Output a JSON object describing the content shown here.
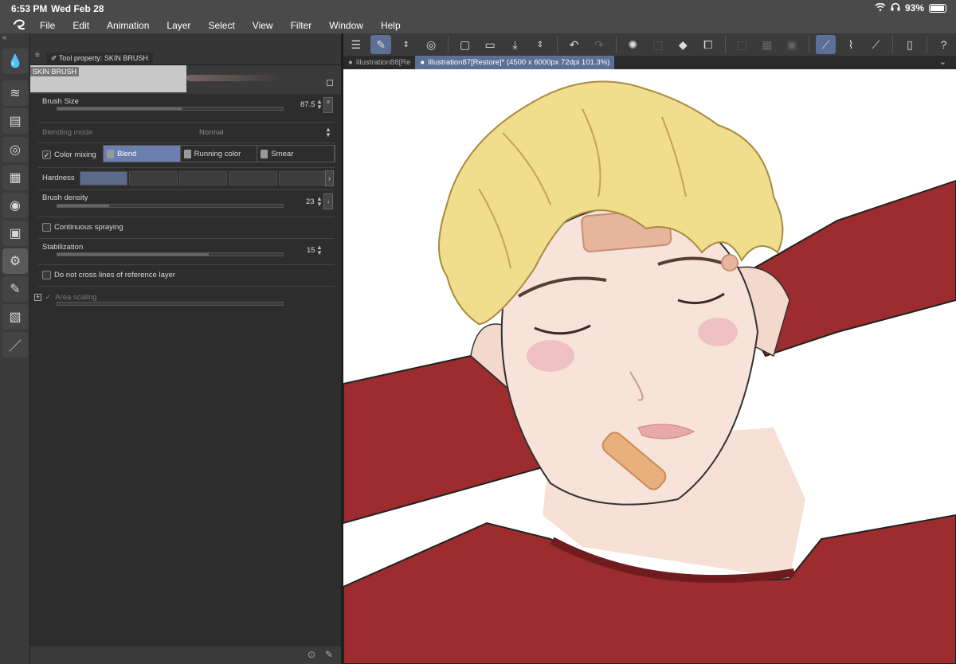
{
  "status": {
    "time": "6:53 PM",
    "date": "Wed Feb 28",
    "battery": "93%",
    "battery_level": 0.93
  },
  "menu": [
    "File",
    "Edit",
    "Animation",
    "Layer",
    "Select",
    "View",
    "Filter",
    "Window",
    "Help"
  ],
  "panel": {
    "tab_title": "Tool property: SKIN BRUSH",
    "brush_name": "SKIN BRUSH",
    "brush_size": {
      "label": "Brush Size",
      "value": "87.5",
      "fraction": 0.55
    },
    "blending_mode": {
      "label": "Blending mode",
      "value": "Normal"
    },
    "color_mixing": {
      "label": "Color mixing",
      "checked": true,
      "options": [
        "Blend",
        "Running color",
        "Smear"
      ],
      "selected": "Blend"
    },
    "hardness": {
      "label": "Hardness",
      "level": 1,
      "steps": 5
    },
    "brush_density": {
      "label": "Brush density",
      "value": "23",
      "fraction": 0.23
    },
    "continuous_spraying": {
      "label": "Continuous spraying",
      "checked": false
    },
    "stabilization": {
      "label": "Stabilization",
      "value": "15",
      "fraction": 0.67
    },
    "do_not_cross": {
      "label": "Do not cross lines of reference layer",
      "checked": false
    },
    "area_scaling": {
      "label": "Area scaling"
    }
  },
  "tabs": [
    {
      "label": "Illustration88[Re",
      "active": false
    },
    {
      "label": "Illustration87[Restore]* (4500 x 6000px 72dpi 101.3%)",
      "active": true
    }
  ],
  "colors": {
    "sweater": "#9c2c2d",
    "hair": "#f1dd8e",
    "skin": "#f6ddd3",
    "accent": "#5c6f96"
  }
}
